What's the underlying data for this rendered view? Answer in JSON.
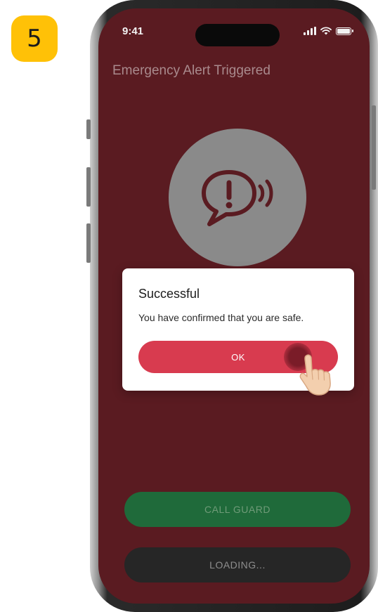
{
  "step": {
    "number": "5"
  },
  "status_bar": {
    "time": "9:41"
  },
  "screen": {
    "title": "Emergency Alert Triggered",
    "icon": "speech-bubble-exclamation-sound-icon"
  },
  "dialog": {
    "title": "Successful",
    "message": "You have confirmed that you are safe.",
    "ok_label": "OK"
  },
  "buttons": {
    "call_guard": "CALL GUARD",
    "loading": "LOADING..."
  },
  "colors": {
    "badge": "#FFC107",
    "screen_background": "#5a1b21",
    "ok_button": "#d83b4f",
    "call_guard": "#1f6a3a",
    "loading": "#262626"
  }
}
